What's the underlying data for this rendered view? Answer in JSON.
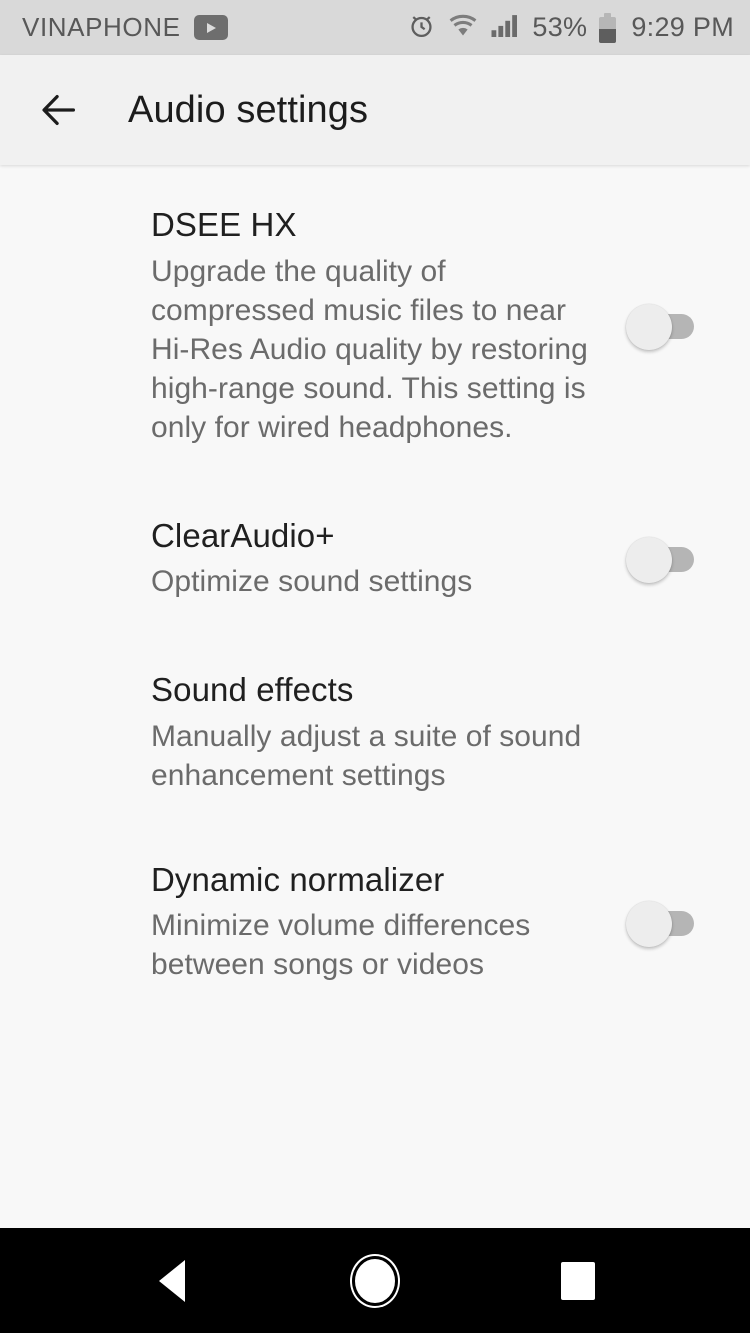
{
  "status_bar": {
    "carrier": "VINAPHONE",
    "youtube_icon": "youtube-play-icon",
    "alarm_icon": "alarm-clock-icon",
    "wifi_icon": "wifi-icon",
    "signal_icon": "cellular-signal-icon",
    "battery_percent": "53%",
    "battery_icon": "battery-half-icon",
    "time": "9:29 PM",
    "background_color": "#d9d9d9",
    "text_color": "#585858"
  },
  "app_bar": {
    "back_icon": "back-arrow-icon",
    "title": "Audio settings",
    "background_color": "#f1f1f1"
  },
  "settings": [
    {
      "id": "dsee-hx",
      "title": "DSEE HX",
      "subtitle": "Upgrade the quality of compressed music files to near Hi-Res Audio quality by restoring high-range sound. This setting is only for wired headphones.",
      "has_toggle": true,
      "toggle_state": "off"
    },
    {
      "id": "clearaudio-plus",
      "title": "ClearAudio+",
      "subtitle": "Optimize sound settings",
      "has_toggle": true,
      "toggle_state": "off"
    },
    {
      "id": "sound-effects",
      "title": "Sound effects",
      "subtitle": "Manually adjust a suite of sound enhancement settings",
      "has_toggle": false,
      "toggle_state": ""
    },
    {
      "id": "dynamic-normalizer",
      "title": "Dynamic normalizer",
      "subtitle": "Minimize volume differences between songs or videos",
      "has_toggle": true,
      "toggle_state": "off"
    }
  ],
  "nav_bar": {
    "back_icon": "nav-back-triangle-icon",
    "home_icon": "nav-home-circle-icon",
    "recents_icon": "nav-recents-square-icon",
    "background_color": "#000000"
  },
  "colors": {
    "content_background": "#f8f8f8",
    "title_text": "#202020",
    "subtitle_text": "#6b6b6b",
    "switch_track_off": "#b5b5b5",
    "switch_thumb_off": "#ededed"
  }
}
